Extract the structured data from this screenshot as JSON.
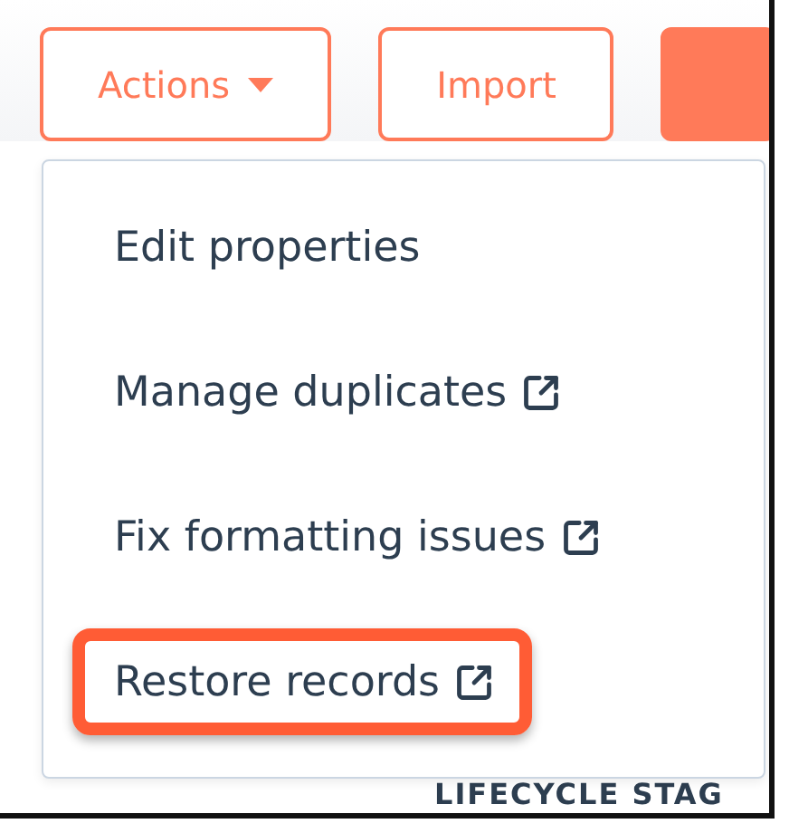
{
  "toolbar": {
    "buttons": [
      {
        "label": "Actions",
        "kind": "dropdown"
      },
      {
        "label": "Import",
        "kind": "outline"
      },
      {
        "kind": "primary"
      }
    ]
  },
  "menu": {
    "items": [
      {
        "label": "Edit properties",
        "external": false,
        "highlighted": false
      },
      {
        "label": "Manage duplicates",
        "external": true,
        "highlighted": false
      },
      {
        "label": "Fix formatting issues",
        "external": true,
        "highlighted": false
      },
      {
        "label": "Restore records",
        "external": true,
        "highlighted": true
      }
    ]
  },
  "table": {
    "column_header": "LIFECYCLE STAG"
  }
}
